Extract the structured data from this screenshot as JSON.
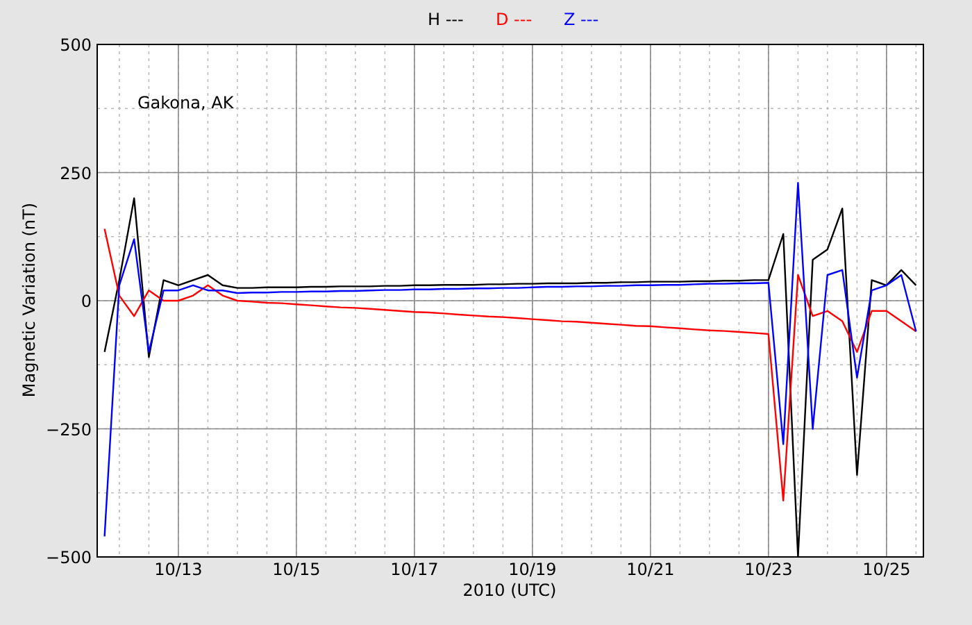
{
  "chart": {
    "chart_data": {
      "type": "line",
      "title": "Gakona, AK",
      "xlabel": "2010 (UTC)",
      "ylabel": "Magnetic Variation (nT)",
      "categories": [
        null,
        null,
        null,
        null,
        null,
        "10/13",
        null,
        null,
        null,
        null,
        null,
        null,
        null,
        "10/15",
        null,
        null,
        null,
        null,
        null,
        null,
        null,
        "10/17",
        null,
        null,
        null,
        null,
        null,
        null,
        null,
        "10/19",
        null,
        null,
        null,
        null,
        null,
        null,
        null,
        "10/21",
        null,
        null,
        null,
        null,
        null,
        null,
        null,
        "10/23",
        null,
        null,
        null,
        null,
        null,
        null,
        null,
        "10/25",
        null,
        null
      ],
      "series": [
        {
          "name": "H ---",
          "color": "#000000",
          "values": [
            -100,
            40,
            200,
            -110,
            40,
            30,
            40,
            50,
            30,
            25,
            25,
            26,
            26,
            26,
            27,
            27,
            28,
            28,
            28,
            29,
            29,
            30,
            30,
            31,
            31,
            31,
            32,
            32,
            33,
            33,
            34,
            34,
            34,
            35,
            35,
            36,
            36,
            37,
            37,
            37,
            38,
            38,
            39,
            39,
            40,
            40,
            130,
            -500,
            80,
            100,
            180,
            -340,
            40,
            30,
            60,
            30
          ]
        },
        {
          "name": "D ---",
          "color": "#ff0000",
          "values": [
            140,
            10,
            -30,
            20,
            0,
            0,
            10,
            30,
            10,
            0,
            -2,
            -4,
            -5,
            -7,
            -9,
            -11,
            -13,
            -14,
            -16,
            -18,
            -20,
            -22,
            -23,
            -25,
            -27,
            -29,
            -31,
            -32,
            -34,
            -36,
            -38,
            -40,
            -41,
            -43,
            -45,
            -47,
            -49,
            -50,
            -52,
            -54,
            -56,
            -58,
            -59,
            -61,
            -63,
            -65,
            -390,
            50,
            -30,
            -20,
            -40,
            -100,
            -20,
            -20,
            -40,
            -60
          ]
        },
        {
          "name": "Z ---",
          "color": "#0000ff",
          "values": [
            -460,
            30,
            120,
            -100,
            20,
            20,
            30,
            20,
            20,
            15,
            16,
            16,
            17,
            17,
            18,
            18,
            19,
            19,
            20,
            21,
            21,
            22,
            22,
            23,
            23,
            24,
            24,
            25,
            25,
            26,
            27,
            27,
            28,
            28,
            29,
            29,
            30,
            30,
            31,
            31,
            32,
            33,
            33,
            34,
            34,
            35,
            -280,
            230,
            -250,
            50,
            60,
            -150,
            20,
            30,
            50,
            -60
          ]
        }
      ],
      "grid": true,
      "ylim": [
        -500,
        500
      ],
      "yticks": [
        {
          "value": 500,
          "label": "500"
        },
        {
          "value": 250,
          "label": "250"
        },
        {
          "value": 0,
          "label": "0"
        },
        {
          "value": -250,
          "label": "−250"
        },
        {
          "value": -500,
          "label": "−500"
        }
      ]
    }
  }
}
